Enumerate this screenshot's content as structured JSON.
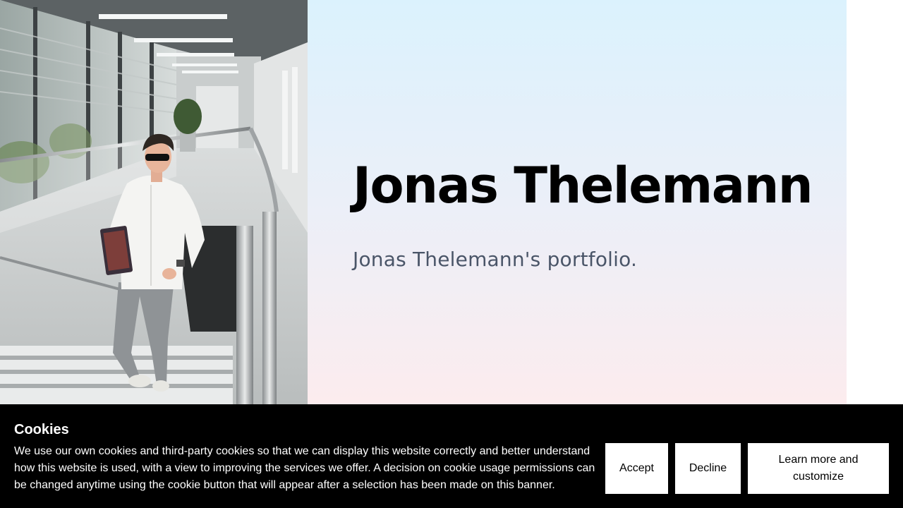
{
  "hero": {
    "name": "Jonas Thelemann",
    "tagline": "Jonas Thelemann's portfolio."
  },
  "photo": {
    "alt": "Jonas Thelemann"
  },
  "cookie_banner": {
    "title": "Cookies",
    "text": "We use our own cookies and third-party cookies so that we can display this website correctly and better understand how this website is used, with a view to improving the services we offer. A decision on cookie usage permissions can be changed anytime using the cookie button that will appear after a selection has been made on this banner.",
    "accept_label": "Accept",
    "decline_label": "Decline",
    "learn_more_label": "Learn more and customize"
  },
  "colors": {
    "hero_gradient_top": "#dbf2fd",
    "hero_gradient_bottom": "#fcecee",
    "tagline": "#4a5568",
    "banner_bg": "#000000",
    "button_bg": "#ffffff"
  }
}
